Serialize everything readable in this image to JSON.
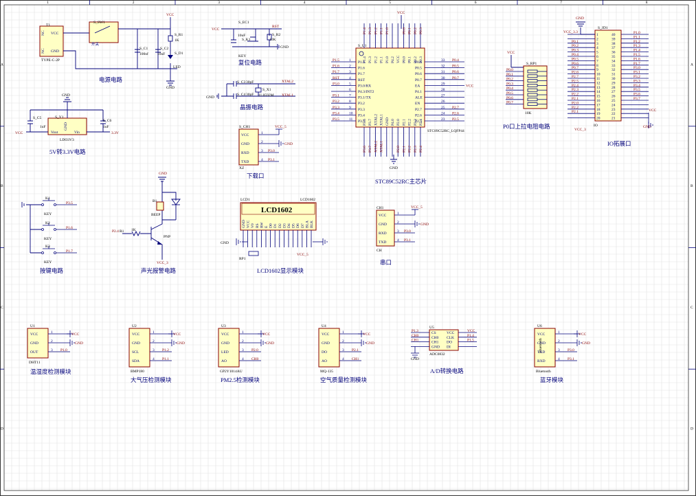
{
  "sheet": {
    "border_columns": [
      "1",
      "2",
      "3",
      "4",
      "5",
      "6",
      "7",
      "8"
    ],
    "border_rows": [
      "A",
      "B",
      "C",
      "D"
    ]
  },
  "sections": {
    "power": "电源电路",
    "ldo": "5V转3.3V电路",
    "reset": "复位电路",
    "crystal": "晶振电路",
    "download": "下载口",
    "mcu": "STC89C52RC主芯片",
    "pullup": "P0口上拉电阻电路",
    "io": "IO拓展口",
    "keys": "按键电路",
    "alarm": "声光报警电路",
    "lcd": "LCD1602显示模块",
    "serial": "串口",
    "temp": "温湿度检测模块",
    "pressure": "大气压检测模块",
    "pm25": "PM2.5检测模块",
    "air": "空气质量检测模块",
    "adc": "A/D转换电路",
    "bt": "蓝牙模块"
  },
  "power": {
    "jack_ref": "T1",
    "jack_type": "TYPE-C-2P",
    "jack_vcc": "VCC",
    "jack_gnd": "GND",
    "jack_nc1": "NC",
    "jack_nc2": "NC",
    "switch_ref": "S_SW1",
    "switch_name": "开关",
    "c1_ref": "S_C1",
    "c1_val": "100nf",
    "c2_ref": "S_C2",
    "c2_val": "10uF",
    "r1_ref": "S_R1",
    "r1_val": "1K",
    "d1_ref": "S_D1",
    "d1_val": "LED",
    "vcc": "VCC",
    "gnd": "GND"
  },
  "ldo": {
    "ref": "S_Y1",
    "part": "LDO3V3",
    "vout": "Vout",
    "vin": "Vin",
    "gndpin": "GND",
    "c5_ref": "S_C5",
    "c5_val": "1uF",
    "c6_ref": "S_C6",
    "c6_val": "1uF",
    "vcc": "VCC",
    "v33": "3.3V",
    "gnd": "GND"
  },
  "reset": {
    "c_ref": "S_EC1",
    "c_val": "10uF",
    "key_ref": "S_K1",
    "key_name": "KEY",
    "r_ref": "S_R2",
    "r_val": "10K",
    "vcc": "VCC",
    "net": "RST",
    "gnd": "GND"
  },
  "crystal": {
    "c3_ref": "S_C3",
    "c3_val": "30pF",
    "c4_ref": "S_C4",
    "c4_val": "30pF",
    "x_ref": "S_X1",
    "x_val": "11.0592M",
    "xtal1": "XTAL2",
    "xtal2": "XTAL1",
    "gnd": "GND"
  },
  "download": {
    "ref": "S_CH1",
    "name": "XZ",
    "pins": [
      "VCC",
      "GND",
      "RXD",
      "TXD"
    ],
    "nets": [
      "VCC_5",
      "GND",
      "P3.0",
      "P3.1"
    ]
  },
  "mcu": {
    "ref": "S_U1",
    "vcc": "VCC",
    "gnd": "GND",
    "part": "STC89C52RC_LQFP44",
    "left_pins": [
      "P1.5",
      "P1.6",
      "P1.7",
      "RST",
      "P3.0/RX",
      "P4.3/INT2",
      "P3.1/TX",
      "P3.2",
      "P3.3",
      "P3.4",
      "P3.5"
    ],
    "left_nets": [
      "P1.5",
      "P1.6",
      "P1.7",
      "RST",
      "P3.0",
      "",
      "P3.1",
      "P3.2",
      "P3.3",
      "P3.4",
      "P3.5"
    ],
    "left_nums": [
      "1",
      "2",
      "3",
      "4",
      "5",
      "6",
      "7",
      "8",
      "9",
      "10",
      "11"
    ],
    "right_pins": [
      "P0.4",
      "P0.5",
      "P0.6",
      "P0.7",
      "EA",
      "P4.1",
      "ALE",
      "EN",
      "P2.7",
      "P2.6",
      "P2.5"
    ],
    "right_nets": [
      "P0.4",
      "P0.5",
      "P0.6",
      "P0.7",
      "VCC",
      "",
      "",
      "",
      "P2.7",
      "P2.6",
      "P2.5"
    ],
    "right_nums": [
      "33",
      "32",
      "31",
      "30",
      "29",
      "28",
      "27",
      "26",
      "25",
      "24",
      "23"
    ],
    "top_pins": [
      "P1.4",
      "P1.3",
      "P1.2",
      "P1.1",
      "P1.0",
      "P4.2",
      "VCC",
      "P0.0",
      "P0.1",
      "P0.2",
      "P0.3"
    ],
    "top_nets": [
      "P1.4",
      "P1.3",
      "P1.2",
      "P1.1",
      "P1.0",
      "",
      "",
      "P0.0",
      "P0.1",
      "P0.2",
      "P0.3"
    ],
    "bottom_pins": [
      "P3.6",
      "P3.7",
      "XTAL2",
      "XTAL1",
      "GND",
      "P4.0",
      "P2.0",
      "P2.1",
      "P2.2",
      "P2.3",
      "P2.4"
    ],
    "bottom_nets": [
      "P3.6",
      "P3.7",
      "XTAL2",
      "XTAL1",
      "",
      "",
      "P2.0",
      "P2.1",
      "P2.2",
      "P2.3",
      "P2.4"
    ]
  },
  "pullup": {
    "ref": "S_RP1",
    "val": "10K",
    "vcc": "VCC",
    "nets": [
      "P0.0",
      "P0.1",
      "P0.2",
      "P0.3",
      "P0.4",
      "P0.5",
      "P0.6",
      "P0.7"
    ]
  },
  "io": {
    "ref": "S_JD1",
    "name": "IO",
    "gnd": "GND",
    "vcc33": "VCC_3.3",
    "vcc": "VCC",
    "vcc3": "VCC_3",
    "gnd2": "GND",
    "left_nums": [
      "1",
      "2",
      "3",
      "4",
      "5",
      "6",
      "7",
      "8",
      "9",
      "10",
      "11",
      "12",
      "13",
      "14",
      "15",
      "16",
      "17",
      "18",
      "19",
      "20"
    ],
    "right_nums": [
      "40",
      "39",
      "38",
      "37",
      "36",
      "35",
      "34",
      "33",
      "32",
      "31",
      "30",
      "29",
      "28",
      "27",
      "26",
      "25",
      "24",
      "23",
      "22",
      "21"
    ],
    "left_nets": [
      "",
      "",
      "P0.1",
      "P0.2",
      "P0.3",
      "P0.4",
      "P0.5",
      "P0.6",
      "P0.7",
      "P2.6",
      "P2.7",
      "P2.5",
      "P2.4",
      "P2.3",
      "P2.2",
      "P2.1",
      "P2.0",
      "P2.2",
      "P2.1",
      ""
    ],
    "right_nets": [
      "P1.0",
      "P1.1",
      "P1.2",
      "P1.3",
      "P1.4",
      "P1.5",
      "P1.6",
      "P1.7",
      "P3.0",
      "P3.1",
      "P3.2",
      "P3.3",
      "P3.4",
      "P3.5",
      "P3.6",
      "P3.7",
      "",
      "",
      "",
      ""
    ]
  },
  "keys": {
    "refs": [
      "K1",
      "K2",
      "K3"
    ],
    "name": "KEY",
    "nets": [
      "P3.5",
      "P1.6",
      "P1.7"
    ]
  },
  "alarm": {
    "buzzer_ref": "B1",
    "buzzer_name": "BEEP",
    "r_ref": "R1",
    "r_val": "1K",
    "q_name": "PNP",
    "net_in": "P2.4",
    "vcc": "VCC_3",
    "gnd": "GND"
  },
  "lcd": {
    "ref": "LCD1",
    "part": "LCD1602",
    "title": "LCD1602",
    "pins": [
      "GND",
      "VCC",
      "V0",
      "RS",
      "RW",
      "E",
      "D0",
      "D1",
      "D2",
      "D3",
      "D4",
      "D5",
      "D6",
      "D7",
      "BLA",
      "BLK"
    ],
    "rp_ref": "RP1",
    "gnd": "GND",
    "vcc": "VCC_5"
  },
  "serial": {
    "ref": "CH1",
    "name": "CH",
    "pins": [
      "VCC",
      "GND",
      "RXD",
      "TXD"
    ],
    "nets": [
      "VCC_5",
      "GND",
      "P3.0",
      "P3.1"
    ]
  },
  "modules": [
    {
      "ref": "U1",
      "part": "DHT11",
      "pins": [
        "VCC",
        "GND",
        "OUT"
      ],
      "nets": [
        "VCC",
        "GND",
        "P1.0"
      ]
    },
    {
      "ref": "U2",
      "part": "BMP180",
      "pins": [
        "VCC",
        "GND",
        "SCL",
        "SDA"
      ],
      "nets": [
        "VCC",
        "GND",
        "P1.2",
        "P1.1"
      ]
    },
    {
      "ref": "U3",
      "part": "GP2Y1014AU",
      "pins": [
        "VCC",
        "GND",
        "LED",
        "AO"
      ],
      "nets": [
        "VCC",
        "GND",
        "P2.0",
        "CH0"
      ]
    },
    {
      "ref": "U4",
      "part": "MQ-135",
      "pins": [
        "VCC",
        "GND",
        "DO",
        "AO"
      ],
      "nets": [
        "VCC",
        "GND",
        "P2.1",
        "CH1"
      ]
    },
    {
      "ref": "U6",
      "part": "Bluetooth",
      "pins": [
        "VCC",
        "GND",
        "TXD",
        "RXD"
      ],
      "nets": [
        "VCC",
        "GND",
        "P3.0",
        "P3.1"
      ]
    }
  ],
  "adc": {
    "ref": "U5",
    "part": "ADC0832",
    "left_pins": [
      "CS",
      "CH0",
      "CH1",
      "GND"
    ],
    "right_pins": [
      "VCC",
      "CLK",
      "DO",
      "DI"
    ],
    "left_nets": [
      "P1.3",
      "CH0",
      "CH1"
    ],
    "right_nets": [
      "VCC",
      "P1.4",
      "P1.5"
    ],
    "gnd": "GND"
  }
}
